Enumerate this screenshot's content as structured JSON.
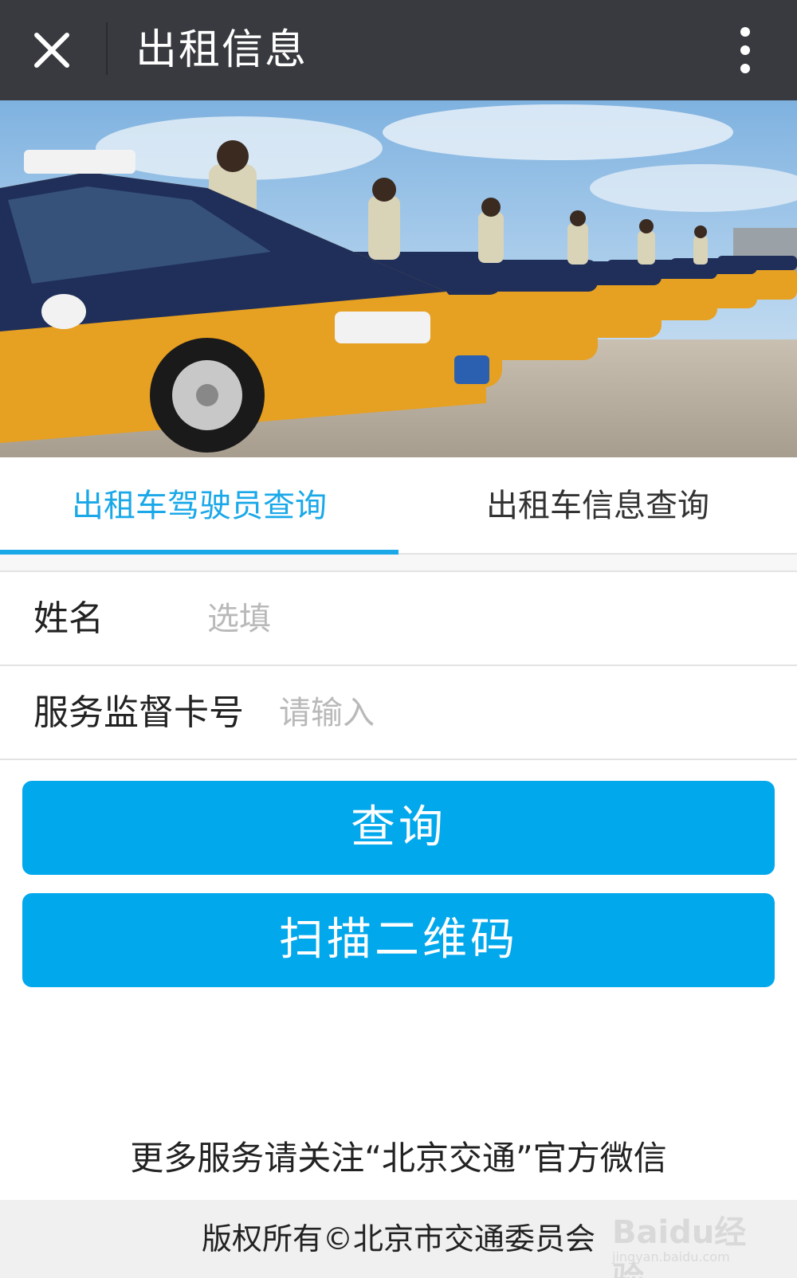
{
  "topbar": {
    "title": "出租信息",
    "close_icon": "close-icon",
    "more_icon": "more-vertical-icon",
    "background": "#393a3f"
  },
  "banner": {
    "image": "taxi-fleet-photo"
  },
  "tabs": [
    {
      "label": "出租车驾驶员查询",
      "active": true
    },
    {
      "label": "出租车信息查询",
      "active": false
    }
  ],
  "form": {
    "name": {
      "label": "姓名",
      "placeholder": "选填",
      "value": ""
    },
    "card": {
      "label": "服务监督卡号",
      "placeholder": "请输入",
      "value": ""
    }
  },
  "buttons": {
    "query": "查询",
    "scan": "扫描二维码"
  },
  "footer": {
    "follow_text": "更多服务请关注“北京交通”官方微信",
    "copyright": "版权所有©北京市交通委员会",
    "watermark_logo": "Baidu经验",
    "watermark_url": "jingyan.baidu.com"
  },
  "colors": {
    "accent": "#1aa8e8",
    "button": "#02a8ec",
    "taxi_yellow": "#e6a022",
    "taxi_blue": "#1f2f5a"
  }
}
